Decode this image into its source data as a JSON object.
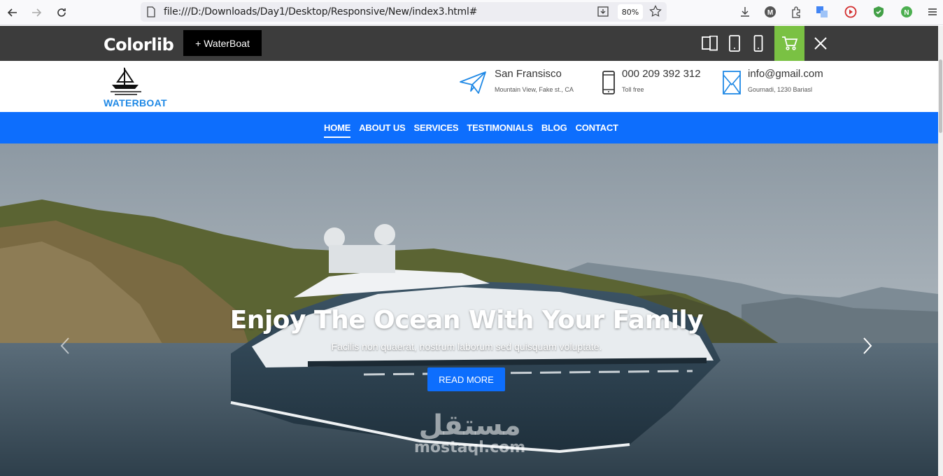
{
  "browser": {
    "url": "file:///D:/Downloads/Day1/Desktop/Responsive/New/index3.html#",
    "zoom": "80%"
  },
  "topbar": {
    "brand": "Colorlib",
    "tag_button": "+ WaterBoat"
  },
  "header": {
    "logo_text": "WATERBOAT",
    "contacts": [
      {
        "title": "San Fransisco",
        "sub": "Mountain View, Fake st., CA",
        "icon": "paper-plane-icon"
      },
      {
        "title": "000 209 392 312",
        "sub": "Toll free",
        "icon": "phone-icon"
      },
      {
        "title": "info@gmail.com",
        "sub": "Gournadi, 1230 Bariasl",
        "icon": "envelope-icon"
      }
    ]
  },
  "nav": {
    "items": [
      "HOME",
      "ABOUT US",
      "SERVICES",
      "TESTIMONIALS",
      "BLOG",
      "CONTACT"
    ],
    "active": "HOME"
  },
  "hero": {
    "title": "Enjoy The Ocean With Your Family",
    "subtitle": "Facilis non quaerat, nostrum laborum sed quisquam voluptate.",
    "button": "READ MORE"
  },
  "watermark": {
    "arabic": "مستقل",
    "latin": "mostaql.com"
  },
  "colors": {
    "primary": "#0d6efd",
    "topbar": "#3c3c3c",
    "cart": "#7ac143",
    "logo": "#1e88e5"
  }
}
